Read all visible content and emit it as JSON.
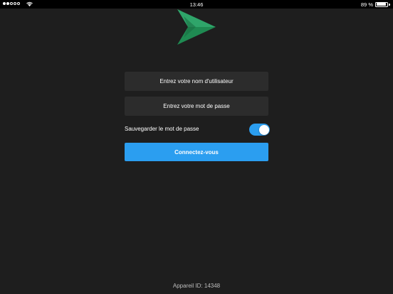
{
  "status_bar": {
    "time": "13:46",
    "battery_percent": "89 %",
    "battery_level": 0.89,
    "signal_icon": "signal-dots-icon",
    "wifi_icon": "wifi-icon"
  },
  "logo": {
    "icon": "paper-plane-logo",
    "colors": [
      "#2fa56a",
      "#1f8a52",
      "#176c40"
    ]
  },
  "login": {
    "username_placeholder": "Entrez votre nom d'utilisateur",
    "username_value": "",
    "password_placeholder": "Entrez votre mot de passe",
    "password_value": "",
    "save_password_label": "Sauvegarder le mot de passe",
    "save_password_on": true,
    "connect_label": "Connectez-vous"
  },
  "footer": {
    "device_id": "Appareil ID: 14348"
  },
  "colors": {
    "background": "#1e1e1e",
    "accent": "#2b9ef0",
    "field_bg": "#2c2c2c"
  }
}
